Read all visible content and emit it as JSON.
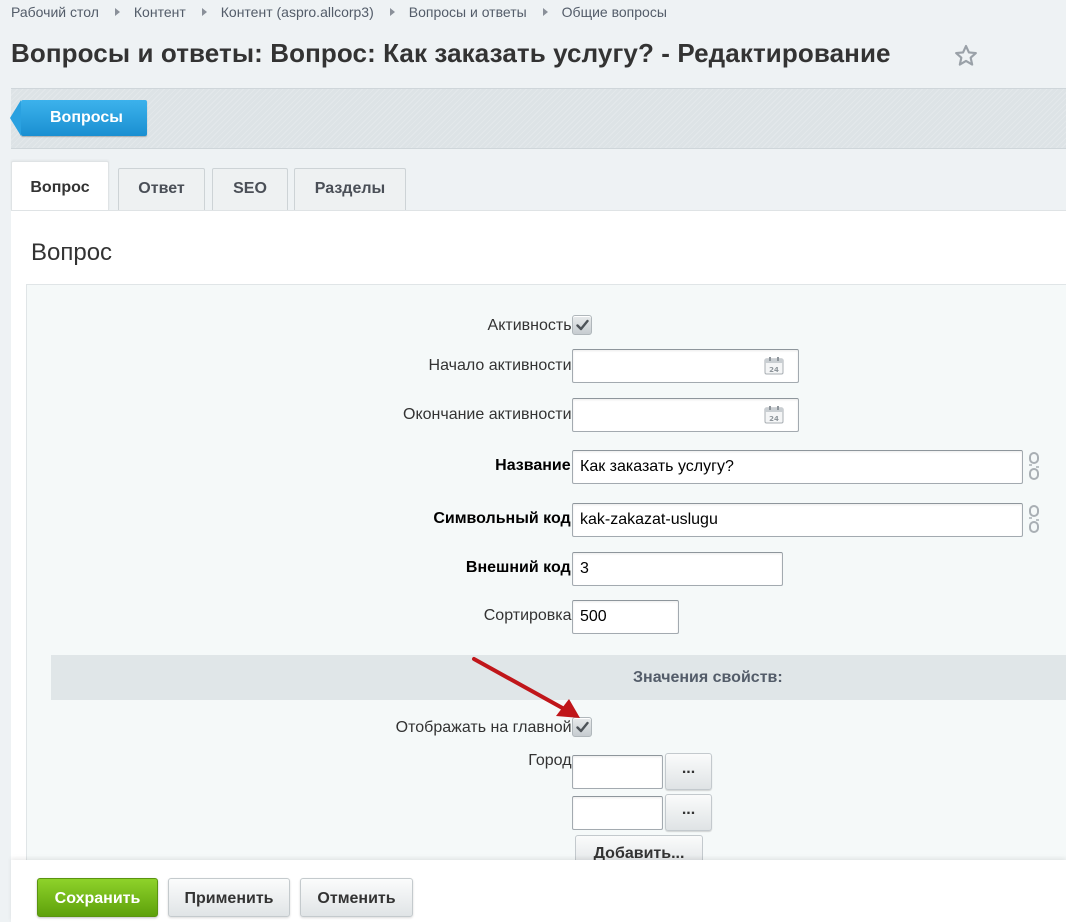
{
  "breadcrumb": [
    "Рабочий стол",
    "Контент",
    "Контент (aspro.allcorp3)",
    "Вопросы и ответы",
    "Общие вопросы"
  ],
  "page_title": "Вопросы и ответы: Вопрос: Как заказать услугу? - Редактирование",
  "toolbar": {
    "back_label": "Вопросы"
  },
  "tabs": [
    {
      "label": "Вопрос",
      "active": true
    },
    {
      "label": "Ответ",
      "active": false
    },
    {
      "label": "SEO",
      "active": false
    },
    {
      "label": "Разделы",
      "active": false
    }
  ],
  "section_title": "Вопрос",
  "form": {
    "active_label": "Активность:",
    "active_checked": true,
    "start_label": "Начало активности:",
    "start_value": "",
    "end_label": "Окончание активности:",
    "end_value": "",
    "name_label": "Название:",
    "name_value": "Как заказать услугу?",
    "code_label": "Символьный код:",
    "code_value": "kak-zakazat-uslugu",
    "xml_label": "Внешний код:",
    "xml_value": "3",
    "sort_label": "Сортировка:",
    "sort_value": "500"
  },
  "properties": {
    "header": "Значения свойств:",
    "show_main_label": "Отображать на главной:",
    "show_main_checked": true,
    "city_label": "Город:",
    "city_values": [
      "",
      ""
    ],
    "dots_label": "...",
    "add_label": "Добавить..."
  },
  "footer": {
    "save": "Сохранить",
    "apply": "Применить",
    "cancel": "Отменить"
  },
  "icons": [
    "star-icon",
    "calendar-icon",
    "link-icon",
    "checkmark-icon",
    "red-arrow-annotation"
  ],
  "colors": {
    "accent_blue": "#1a8fd1",
    "save_green": "#6cb015",
    "annotation_red": "#c0161a"
  }
}
